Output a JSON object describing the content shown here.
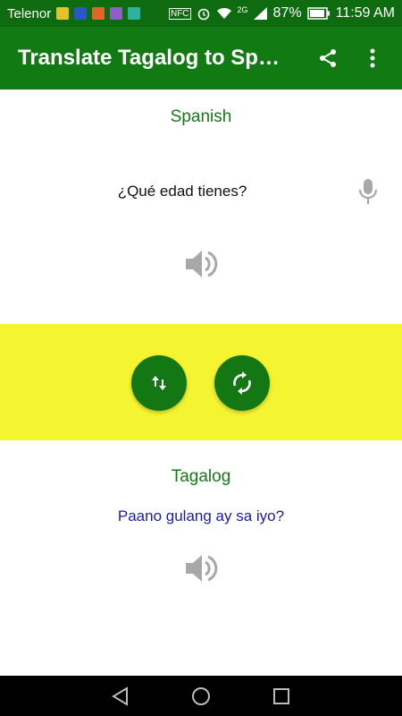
{
  "status_bar": {
    "carrier": "Telenor",
    "battery": "87%",
    "network": "2G",
    "nfc": "NFC",
    "time": "11:59 AM",
    "notification_icons": [
      "cleaner-icon",
      "messenger-icon",
      "game-icon",
      "gallery-icon",
      "downloads-icon"
    ]
  },
  "app_bar": {
    "title": "Translate Tagalog to Spa…",
    "share_icon": "share-icon",
    "menu_icon": "more-vert-icon"
  },
  "source": {
    "language": "Spanish",
    "text": "¿Qué edad tienes?",
    "mic_icon": "microphone-icon",
    "speaker_icon": "speaker-icon"
  },
  "controls": {
    "swap_icon": "swap-vert-icon",
    "refresh_icon": "refresh-icon"
  },
  "target": {
    "language": "Tagalog",
    "text": "Paano gulang ay sa iyo?",
    "speaker_icon": "speaker-icon"
  },
  "colors": {
    "app_bar": "#127a12",
    "status_bar": "#0f6b0f",
    "accent_green": "#137813",
    "band_yellow": "#f4f430",
    "translation_blue": "#1a1aa8"
  },
  "nav_bar": {
    "back_icon": "back-triangle-icon",
    "home_icon": "home-circle-icon",
    "recents_icon": "recents-square-icon"
  }
}
